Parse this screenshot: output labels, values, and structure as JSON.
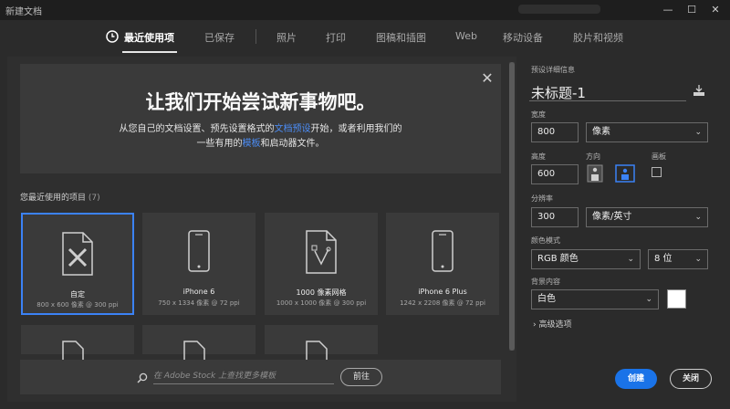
{
  "window": {
    "title": "新建文档",
    "minimize": "—",
    "maximize": "☐",
    "close": "✕"
  },
  "tabs": [
    {
      "label": "最近使用项",
      "active": true
    },
    {
      "label": "已保存"
    },
    {
      "label": "照片"
    },
    {
      "label": "打印"
    },
    {
      "label": "图稿和插图"
    },
    {
      "label": "Web"
    },
    {
      "label": "移动设备"
    },
    {
      "label": "胶片和视频"
    }
  ],
  "hero": {
    "title": "让我们开始尝试新事物吧。",
    "line1_a": "从您自己的文档设置、预先设置格式的",
    "line1_link": "文档预设",
    "line1_b": "开始，或者利用我们的",
    "line2_a": "一些有用的",
    "line2_link": "模板",
    "line2_b": "和启动器文件。",
    "close": "✕"
  },
  "recent": {
    "label": "您最近使用的项目",
    "count": "(7)",
    "items": [
      {
        "name": "自定",
        "sub": "800 x 600 像素 @ 300 ppi",
        "icon": "custom-document-icon"
      },
      {
        "name": "iPhone 6",
        "sub": "750 x 1334 像素 @ 72 ppi",
        "icon": "phone-icon"
      },
      {
        "name": "1000 像素网格",
        "sub": "1000 x 1000 像素 @ 300 ppi",
        "icon": "grid-document-icon"
      },
      {
        "name": "iPhone 6 Plus",
        "sub": "1242 x 2208 像素 @ 72 ppi",
        "icon": "phone-icon"
      }
    ]
  },
  "search": {
    "placeholder": "在 Adobe Stock 上查找更多模板",
    "go": "前往"
  },
  "details": {
    "header": "预设详细信息",
    "doc_title": "未标题-1",
    "width_label": "宽度",
    "width_value": "800",
    "width_unit": "像素",
    "height_label": "高度",
    "height_value": "600",
    "orientation_label": "方向",
    "artboard_label": "画板",
    "resolution_label": "分辨率",
    "resolution_value": "300",
    "resolution_unit": "像素/英寸",
    "color_mode_label": "颜色模式",
    "color_mode_value": "RGB 颜色",
    "bit_depth": "8 位",
    "background_label": "背景内容",
    "background_value": "白色",
    "advanced": "高级选项"
  },
  "actions": {
    "create": "创建",
    "close": "关闭"
  },
  "colors": {
    "accent": "#1a73e8",
    "selected_border": "#3b82f6",
    "link": "#4c8df6"
  }
}
